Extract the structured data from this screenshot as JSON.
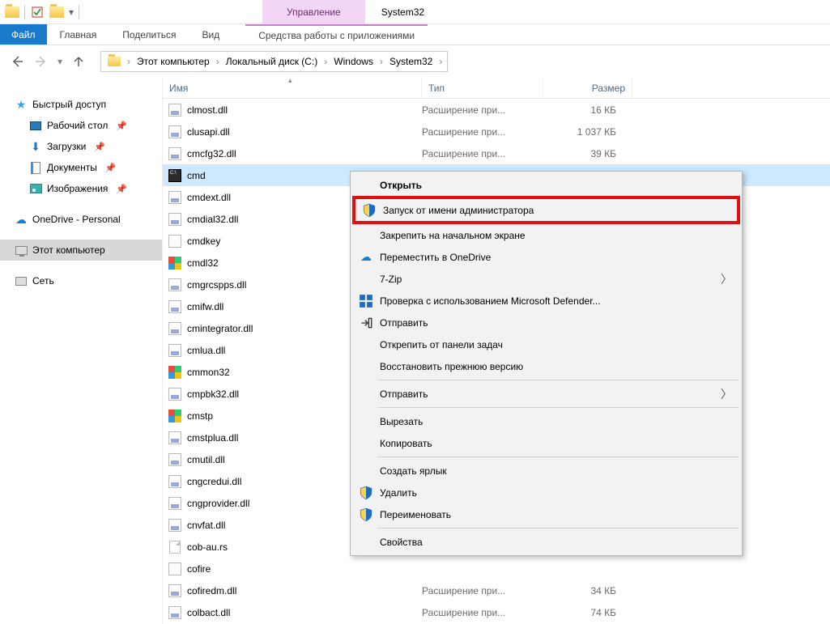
{
  "title": "System32",
  "context_tab": "Управление",
  "ribbon": {
    "file": "Файл",
    "tabs": [
      "Главная",
      "Поделиться",
      "Вид"
    ],
    "context_label": "Средства работы с приложениями"
  },
  "breadcrumb": [
    "Этот компьютер",
    "Локальный диск (C:)",
    "Windows",
    "System32"
  ],
  "columns": {
    "name": "Имя",
    "type": "Тип",
    "size": "Размер"
  },
  "sidebar": {
    "quick": "Быстрый доступ",
    "items": [
      {
        "label": "Рабочий стол",
        "pinned": true
      },
      {
        "label": "Загрузки",
        "pinned": true
      },
      {
        "label": "Документы",
        "pinned": true
      },
      {
        "label": "Изображения",
        "pinned": true
      }
    ],
    "onedrive": "OneDrive - Personal",
    "thispc": "Этот компьютер",
    "network": "Сеть"
  },
  "files": [
    {
      "name": "clmost.dll",
      "type": "Расширение при...",
      "size": "16 КБ",
      "icon": "dll"
    },
    {
      "name": "clusapi.dll",
      "type": "Расширение при...",
      "size": "1 037 КБ",
      "icon": "dll"
    },
    {
      "name": "cmcfg32.dll",
      "type": "Расширение при...",
      "size": "39 КБ",
      "icon": "dll"
    },
    {
      "name": "cmd",
      "type": "",
      "size": "",
      "icon": "exe",
      "selected": true
    },
    {
      "name": "cmdext.dll",
      "type": "",
      "size": "",
      "icon": "dll"
    },
    {
      "name": "cmdial32.dll",
      "type": "",
      "size": "",
      "icon": "dll"
    },
    {
      "name": "cmdkey",
      "type": "",
      "size": "",
      "icon": "mui"
    },
    {
      "name": "cmdl32",
      "type": "",
      "size": "",
      "icon": "color"
    },
    {
      "name": "cmgrcspps.dll",
      "type": "",
      "size": "",
      "icon": "dll"
    },
    {
      "name": "cmifw.dll",
      "type": "",
      "size": "",
      "icon": "dll"
    },
    {
      "name": "cmintegrator.dll",
      "type": "",
      "size": "",
      "icon": "dll"
    },
    {
      "name": "cmlua.dll",
      "type": "",
      "size": "",
      "icon": "dll"
    },
    {
      "name": "cmmon32",
      "type": "",
      "size": "",
      "icon": "color"
    },
    {
      "name": "cmpbk32.dll",
      "type": "",
      "size": "",
      "icon": "dll"
    },
    {
      "name": "cmstp",
      "type": "",
      "size": "",
      "icon": "color"
    },
    {
      "name": "cmstplua.dll",
      "type": "",
      "size": "",
      "icon": "dll"
    },
    {
      "name": "cmutil.dll",
      "type": "",
      "size": "",
      "icon": "dll"
    },
    {
      "name": "cngcredui.dll",
      "type": "",
      "size": "",
      "icon": "dll"
    },
    {
      "name": "cngprovider.dll",
      "type": "",
      "size": "",
      "icon": "dll"
    },
    {
      "name": "cnvfat.dll",
      "type": "",
      "size": "",
      "icon": "dll"
    },
    {
      "name": "cob-au.rs",
      "type": "",
      "size": "",
      "icon": "rs"
    },
    {
      "name": "cofire",
      "type": "",
      "size": "",
      "icon": "mui"
    },
    {
      "name": "cofiredm.dll",
      "type": "Расширение при...",
      "size": "34 КБ",
      "icon": "dll"
    },
    {
      "name": "colbact.dll",
      "type": "Расширение при...",
      "size": "74 КБ",
      "icon": "dll"
    }
  ],
  "context_menu": {
    "open": "Открыть",
    "run_admin": "Запуск от имени администратора",
    "pin_start": "Закрепить на начальном экране",
    "onedrive": "Переместить в OneDrive",
    "sevenzip": "7-Zip",
    "defender": "Проверка с использованием Microsoft Defender...",
    "share": "Отправить",
    "unpin_tb": "Открепить от панели задач",
    "restore": "Восстановить прежнюю версию",
    "sendto": "Отправить",
    "cut": "Вырезать",
    "copy": "Копировать",
    "shortcut": "Создать ярлык",
    "delete": "Удалить",
    "rename": "Переименовать",
    "properties": "Свойства"
  }
}
